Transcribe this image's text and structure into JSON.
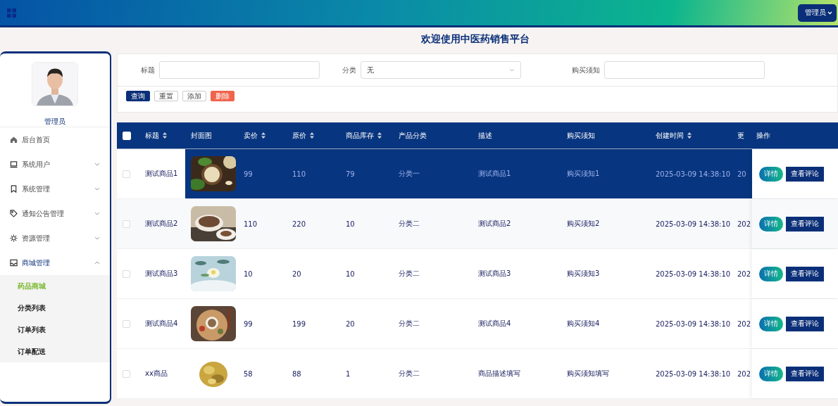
{
  "header": {
    "user_menu": "管理员"
  },
  "page_title": "欢迎使用中医药销售平台",
  "sidebar": {
    "user_name": "管理员",
    "menu": [
      {
        "label": "后台首页"
      },
      {
        "label": "系统用户",
        "expanded": false
      },
      {
        "label": "系统管理",
        "expanded": false
      },
      {
        "label": "通知公告管理",
        "expanded": false
      },
      {
        "label": "资源管理",
        "expanded": false
      },
      {
        "label": "商城管理",
        "expanded": true,
        "children": [
          {
            "label": "药品商城",
            "selected": true
          },
          {
            "label": "分类列表",
            "selected": false
          },
          {
            "label": "订单列表",
            "selected": false
          },
          {
            "label": "订单配送",
            "selected": false
          }
        ]
      }
    ]
  },
  "search": {
    "fields": [
      {
        "label": "标题",
        "kind": "input"
      },
      {
        "label": "分类",
        "kind": "select",
        "value": "无"
      },
      {
        "label": "购买须知",
        "kind": "input"
      }
    ],
    "buttons": [
      {
        "label": "查询",
        "kind": "primary"
      },
      {
        "label": "重置",
        "kind": "default"
      },
      {
        "label": "添加",
        "kind": "default"
      },
      {
        "label": "删除",
        "kind": "danger"
      }
    ]
  },
  "table": {
    "select_all": {
      "checked": false
    },
    "columns": [
      {
        "label": "标题",
        "kind": "text",
        "sortable": true
      },
      {
        "label": "封面图",
        "sortable": false
      },
      {
        "label": "卖价",
        "kind": "text",
        "sortable": true
      },
      {
        "label": "原价",
        "kind": "text",
        "sortable": true
      },
      {
        "label": "商品库存",
        "kind": "text",
        "sortable": true
      },
      {
        "label": "产品分类",
        "kind": "text",
        "sortable": false
      },
      {
        "label": "描述",
        "kind": "text",
        "sortable": false
      },
      {
        "label": "购买须知",
        "kind": "text",
        "sortable": false
      },
      {
        "label": "创建时间",
        "kind": "text",
        "sortable": true
      },
      {
        "label": "更",
        "kind": "text",
        "sortable": false
      }
    ],
    "actions_column": "操作",
    "rows": [
      {
        "selected": true,
        "checked": false,
        "cells": [
          "测试商品1",
          "",
          "99",
          "110",
          "79",
          "分类一",
          "测试商品1",
          "购买须知1",
          "2025-03-09 14:38:10",
          "20"
        ],
        "actions": [
          "详情",
          "查看评论"
        ]
      },
      {
        "selected": false,
        "checked": false,
        "cells": [
          "测试商品2",
          "",
          "110",
          "220",
          "10",
          "分类二",
          "测试商品2",
          "购买须知2",
          "2025-03-09 14:38:10",
          "202"
        ],
        "actions": [
          "详情",
          "查看评论"
        ]
      },
      {
        "selected": false,
        "checked": false,
        "cells": [
          "测试商品3",
          "",
          "10",
          "20",
          "10",
          "分类二",
          "测试商品3",
          "购买须知3",
          "2025-03-09 14:38:10",
          "202"
        ],
        "actions": [
          "详情",
          "查看评论"
        ]
      },
      {
        "selected": false,
        "checked": false,
        "cells": [
          "测试商品4",
          "",
          "99",
          "199",
          "20",
          "分类二",
          "测试商品4",
          "购买须知4",
          "2025-03-09 14:38:10",
          "202"
        ],
        "actions": [
          "详情",
          "查看评论"
        ]
      },
      {
        "selected": false,
        "checked": false,
        "cells": [
          "xx商品",
          "",
          "58",
          "88",
          "1",
          "分类二",
          "商品描述填写",
          "购买须知填写",
          "2025-03-09 14:38:10",
          "202"
        ],
        "actions": [
          "详情",
          "查看评论"
        ]
      }
    ]
  }
}
